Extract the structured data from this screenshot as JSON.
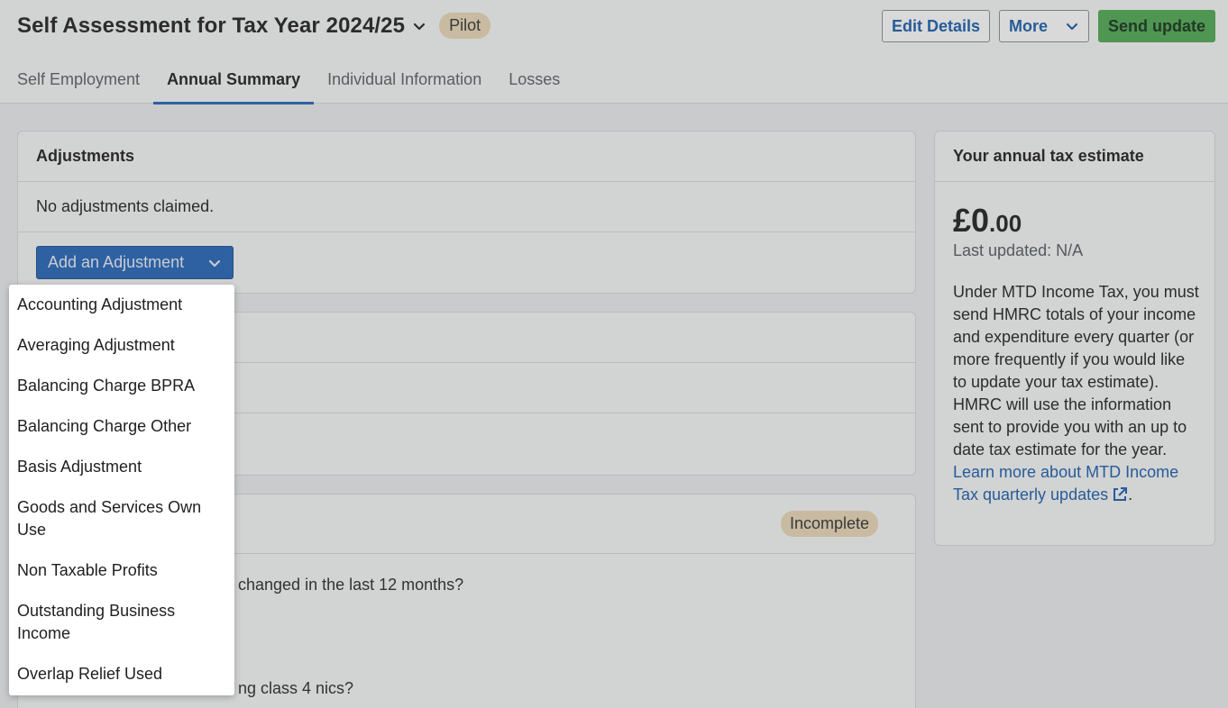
{
  "header": {
    "title": "Self Assessment for Tax Year 2024/25",
    "badge": "Pilot",
    "edit_label": "Edit Details",
    "more_label": "More",
    "send_label": "Send update"
  },
  "tabs": [
    {
      "label": "Self Employment"
    },
    {
      "label": "Annual Summary"
    },
    {
      "label": "Individual Information"
    },
    {
      "label": "Losses"
    }
  ],
  "adjustments": {
    "title": "Adjustments",
    "empty_text": "No adjustments claimed.",
    "add_button": "Add an Adjustment"
  },
  "card3": {
    "status": "Incomplete",
    "q1_fragment": "changed in the last 12 months?",
    "q2_fragment": "ng class 4 nics?"
  },
  "estimate": {
    "title": "Your annual tax estimate",
    "amount_main": "£0",
    "amount_pence": ".00",
    "last_updated": "Last updated: N/A",
    "description": "Under MTD Income Tax, you must send HMRC totals of your income and expenditure every quarter (or more frequently if you would like to update your tax estimate). HMRC will use the information sent to provide you with an up to date tax estimate for the year. ",
    "link_text": "Learn more about MTD Income Tax quarterly updates",
    "trailing": "."
  },
  "dropdown": {
    "items": [
      "Accounting Adjustment",
      "Averaging Adjustment",
      "Balancing Charge BPRA",
      "Balancing Charge Other",
      "Basis Adjustment",
      "Goods and Services Own Use",
      "Non Taxable Profits",
      "Outstanding Business Income",
      "Overlap Relief Used"
    ]
  },
  "colors": {
    "accent": "#2566b8",
    "success": "#4fa952",
    "badge": "#e9d9b8"
  }
}
